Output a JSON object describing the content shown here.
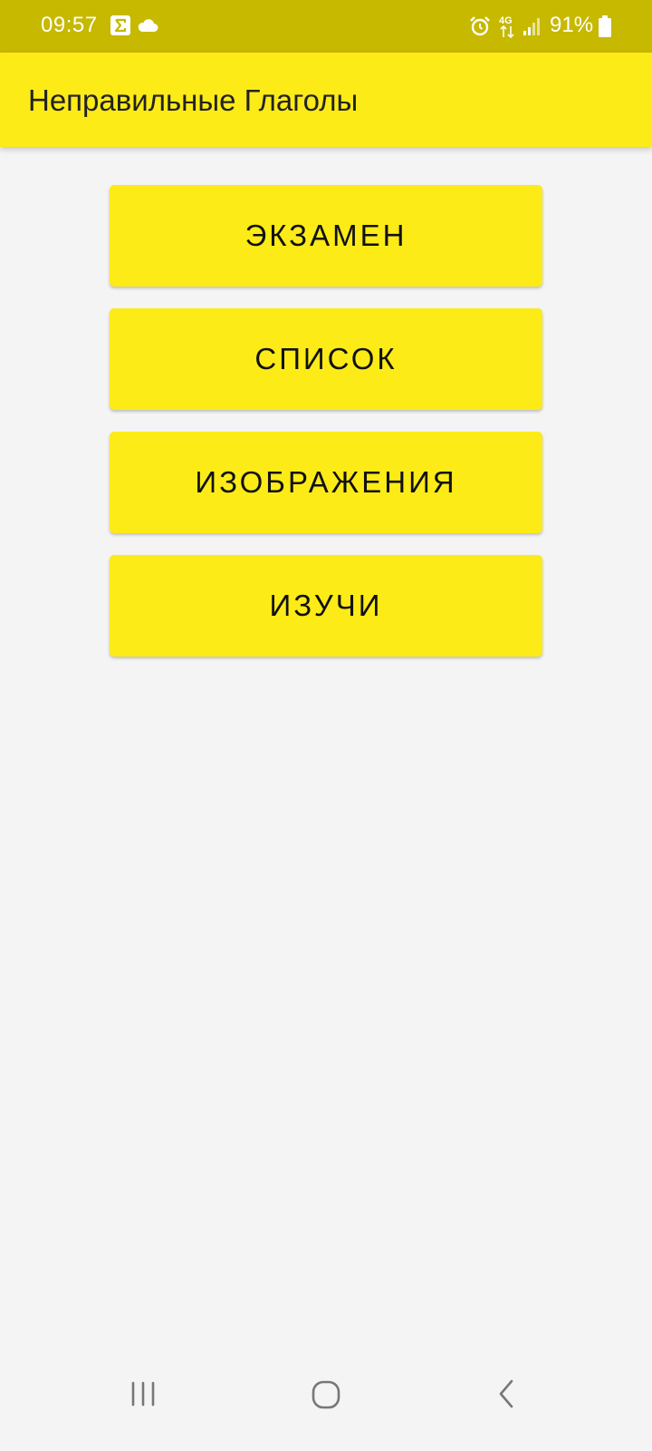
{
  "status_bar": {
    "time": "09:57",
    "battery_percent": "91%",
    "network_label": "4G",
    "icons": [
      "sigma-icon",
      "cloud-icon",
      "alarm-icon",
      "network-4g-icon",
      "signal-icon",
      "battery-icon"
    ]
  },
  "app_bar": {
    "title": "Неправильные Глаголы"
  },
  "menu": {
    "buttons": [
      {
        "label": "ЭКЗАМЕН"
      },
      {
        "label": "СПИСОК"
      },
      {
        "label": "ИЗОБРАЖЕНИЯ"
      },
      {
        "label": "ИЗУЧИ"
      }
    ]
  },
  "nav_bar": {
    "icons": [
      "recent-apps-icon",
      "home-icon",
      "back-icon"
    ]
  },
  "colors": {
    "status_bar": "#c7b800",
    "accent_yellow": "#fceb17",
    "background": "#f4f4f4",
    "text_dark": "#111111"
  }
}
